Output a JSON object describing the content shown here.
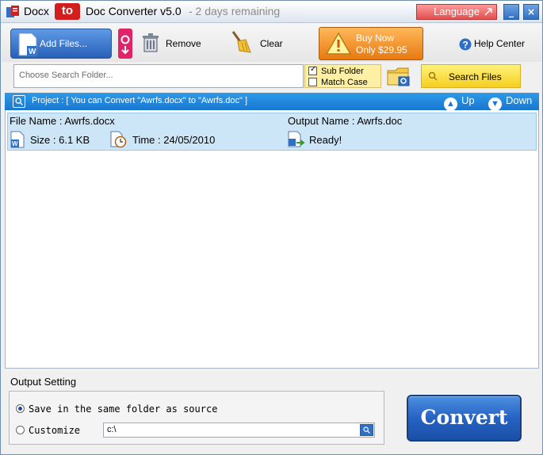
{
  "window": {
    "title_prefix": "Docx",
    "title_to": "to",
    "title_suffix": "Doc Converter v5.0",
    "remaining": "- 2 days remaining",
    "language_label": "Language",
    "minimize_label": "_",
    "close_label": "×"
  },
  "toolbar": {
    "add_files_label": "Add Files...",
    "remove_label": "Remove",
    "clear_label": "Clear",
    "buy_now_line1": "Buy Now",
    "buy_now_line2": "Only $29.95",
    "help_label": "Help Center"
  },
  "search": {
    "placeholder": "Choose Search Folder...",
    "sub_folder_label": "Sub Folder",
    "sub_folder_checked": true,
    "match_case_label": "Match Case",
    "match_case_checked": false,
    "search_files_label": "Search Files"
  },
  "project": {
    "text": "Project : [ You can Convert \"Awrfs.docx\" to \"Awrfs.doc\" ]",
    "up_label": "Up",
    "down_label": "Down"
  },
  "files": [
    {
      "file_name": "File Name : Awrfs.docx",
      "output_name": "Output Name : Awrfs.doc",
      "size": "Size : 6.1 KB",
      "time": "Time : 24/05/2010",
      "status": "Ready!"
    }
  ],
  "output": {
    "title": "Output Setting",
    "same_folder_label": "Save in the same folder as source",
    "customize_label": "Customize",
    "path_value": "c:\\",
    "selected": "same_folder"
  },
  "convert_label": "Convert",
  "colors": {
    "accent_blue": "#1877d0",
    "buy_orange": "#e77a10",
    "title_red": "#d21e1e",
    "search_yellow": "#f6cf20"
  }
}
